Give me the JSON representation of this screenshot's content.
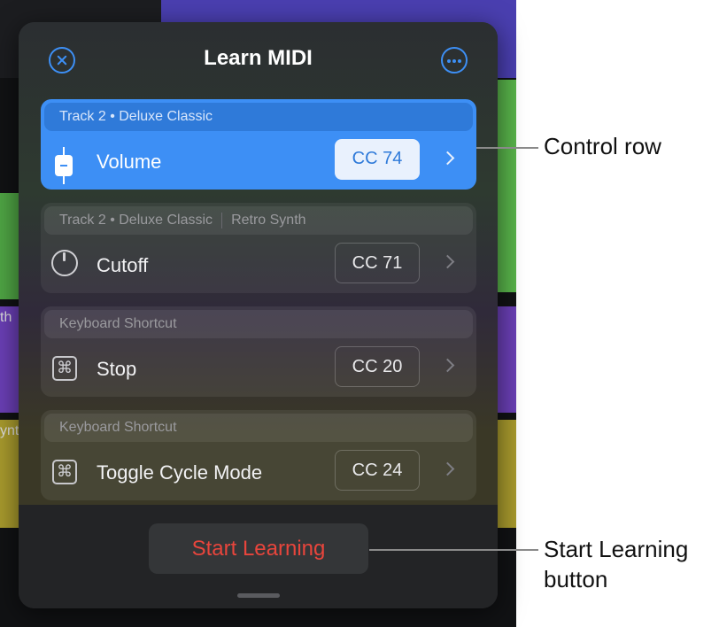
{
  "popover": {
    "title": "Learn MIDI",
    "close_icon": "close-icon",
    "more_icon": "more-icon"
  },
  "rows": [
    {
      "header": "Track 2 • Deluxe Classic",
      "header_extra": "",
      "label": "Volume",
      "cc": "CC 74",
      "icon": "fader-icon",
      "selected": true
    },
    {
      "header": "Track 2 • Deluxe Classic",
      "header_extra": "Retro Synth",
      "label": "Cutoff",
      "cc": "CC 71",
      "icon": "knob-icon",
      "selected": false
    },
    {
      "header": "Keyboard Shortcut",
      "header_extra": "",
      "label": "Stop",
      "cc": "CC 20",
      "icon": "command-icon",
      "selected": false
    },
    {
      "header": "Keyboard Shortcut",
      "header_extra": "",
      "label": "Toggle Cycle Mode",
      "cc": "CC 24",
      "icon": "command-icon",
      "selected": false
    }
  ],
  "footer": {
    "start_button": "Start Learning"
  },
  "callouts": {
    "control_row": "Control row",
    "start_learning_line1": "Start Learning",
    "start_learning_line2": "button"
  },
  "background": {
    "left_fragment_1": "th",
    "left_fragment_2": "ynt"
  },
  "colors": {
    "accent": "#3d8ff5",
    "start_text": "#e8453c"
  }
}
